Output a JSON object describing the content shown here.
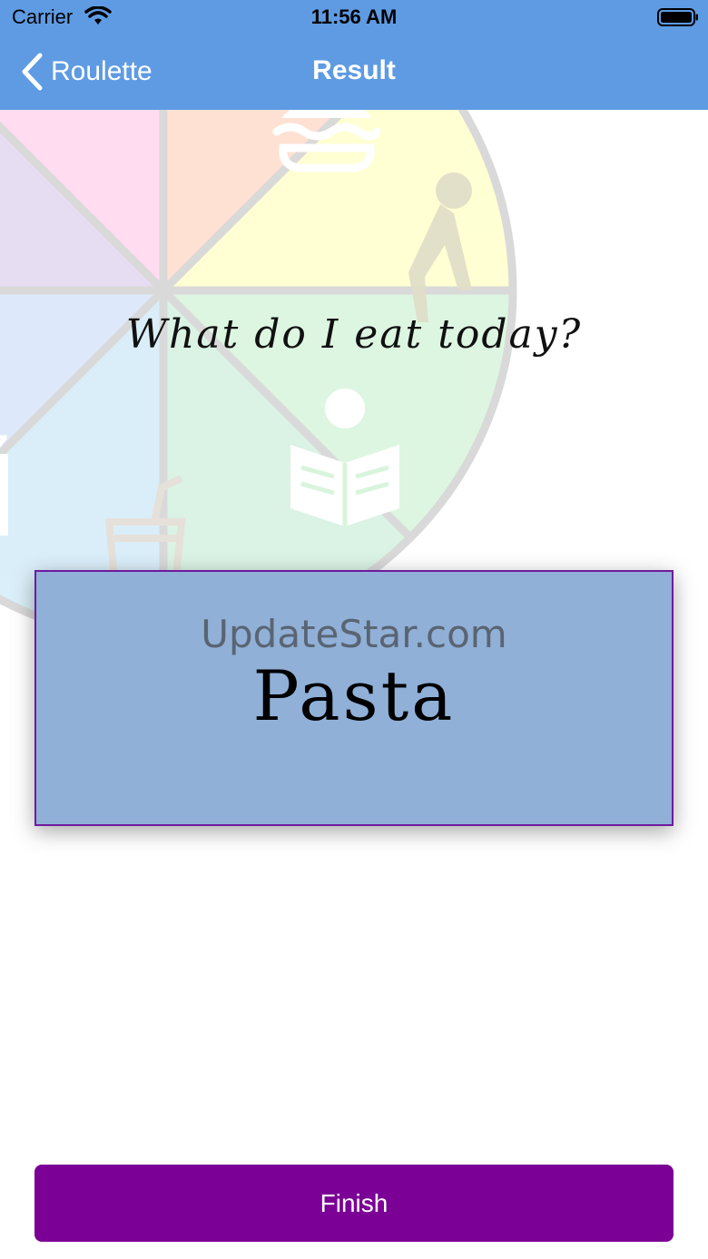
{
  "status_bar": {
    "carrier": "Carrier",
    "time": "11:56 AM",
    "wifi_icon": "wifi-icon",
    "battery_icon": "battery-full-icon"
  },
  "nav": {
    "back_label": "Roulette",
    "back_icon": "chevron-left-icon",
    "title": "Result",
    "background_color": "#5e9be3"
  },
  "background_wheel": {
    "segments": [
      {
        "color": "#ffd9cc",
        "icon": "burger-icon"
      },
      {
        "color": "#ffffcc",
        "icon": "exercise-icon"
      },
      {
        "color": "#d8f5dc",
        "icon": "reading-icon"
      },
      {
        "color": "#d4ecf8",
        "icon": "drink-icon"
      },
      {
        "color": "#d8e4fa",
        "icon": "sleep-icon"
      },
      {
        "color": "#e3d8f0",
        "icon": ""
      },
      {
        "color": "#ffd6ee",
        "icon": ""
      },
      {
        "color": "#ffd8d8",
        "icon": ""
      }
    ]
  },
  "question": "What do I eat today?",
  "result": {
    "watermark": "UpdateStar.com",
    "value": "Pasta",
    "card_color": "#90b0d7",
    "border_color": "#6f1a9e"
  },
  "finish_button": {
    "label": "Finish",
    "color": "#7b0096"
  }
}
